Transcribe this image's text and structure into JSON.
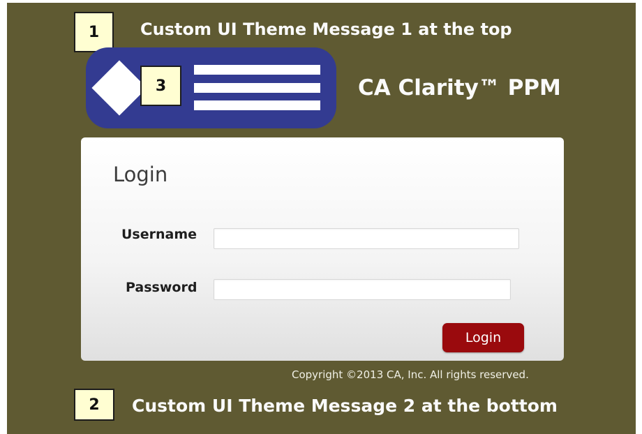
{
  "annotations": {
    "callout_1": "1",
    "callout_2": "2",
    "callout_3": "3"
  },
  "theme_messages": {
    "top": "Custom UI Theme Message 1 at the top",
    "bottom": "Custom UI Theme Message 2 at the bottom"
  },
  "header": {
    "logo_icon": "menu-logo-icon",
    "brand_name": "CA Clarity™ PPM"
  },
  "login": {
    "title": "Login",
    "username_label": "Username",
    "username_value": "",
    "password_label": "Password",
    "password_value": "",
    "submit_label": "Login"
  },
  "footer": {
    "copyright": "Copyright ©2013 CA, Inc. All rights reserved."
  },
  "colors": {
    "page_background": "#5f5a32",
    "logo_background": "#333b91",
    "login_button": "#9a0a0d",
    "callout_background": "#fffed2"
  }
}
